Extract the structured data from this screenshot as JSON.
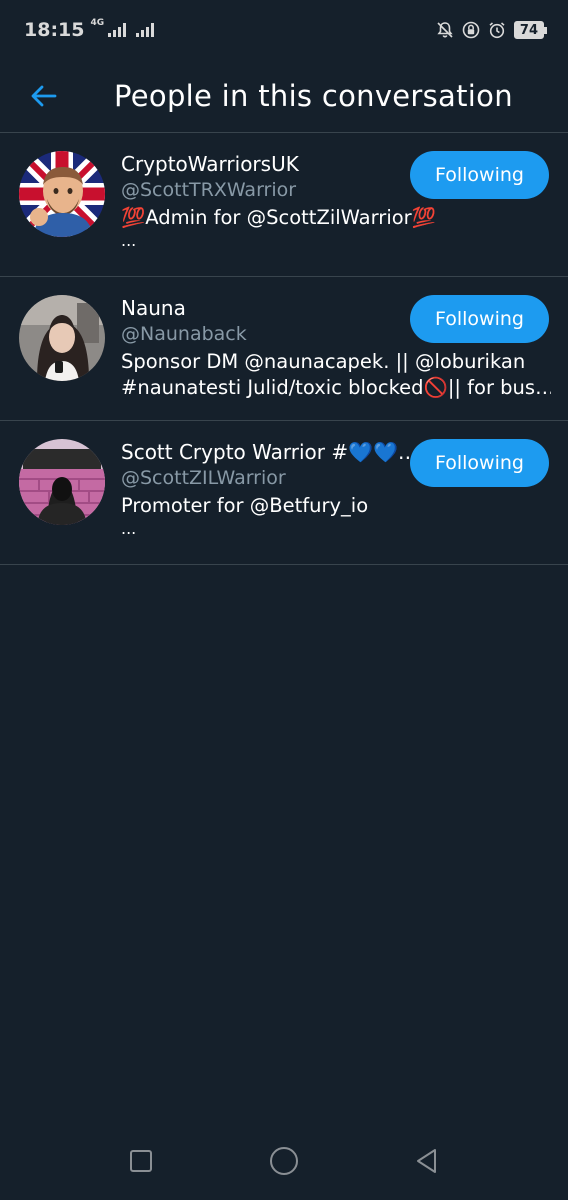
{
  "status_bar": {
    "time": "18:15",
    "network": "4G",
    "battery": "74",
    "icons": [
      "mute-icon",
      "lock-icon",
      "alarm-icon",
      "battery-icon"
    ]
  },
  "header": {
    "title": "People in this conversation",
    "back_icon": "arrow-left-icon"
  },
  "people": [
    {
      "name": "CryptoWarriorsUK",
      "handle": "@ScottTRXWarrior",
      "bio_lines": [
        "💯Admin for @ScottZilWarrior💯"
      ],
      "bio_more": "...",
      "button": "Following"
    },
    {
      "name": "Nauna",
      "handle": "@Naunaback",
      "bio_lines": [
        "Sponsor DM @naunacapek. || @loburikan",
        "#naunatesti Julid/toxic blocked🚫|| for bus…"
      ],
      "bio_more": "",
      "button": "Following"
    },
    {
      "name": "Scott Crypto Warrior #💙💙…",
      "handle": "@ScottZILWarrior",
      "bio_lines": [
        "Promoter for @Betfury_io"
      ],
      "bio_more": "...",
      "button": "Following"
    }
  ],
  "nav_bar": {
    "icons": [
      "recents-square-icon",
      "home-circle-icon",
      "back-triangle-icon"
    ]
  },
  "colors": {
    "background": "#15202b",
    "accent": "#1d9bf0",
    "divider": "#38444d",
    "secondary_text": "#8899a6"
  }
}
